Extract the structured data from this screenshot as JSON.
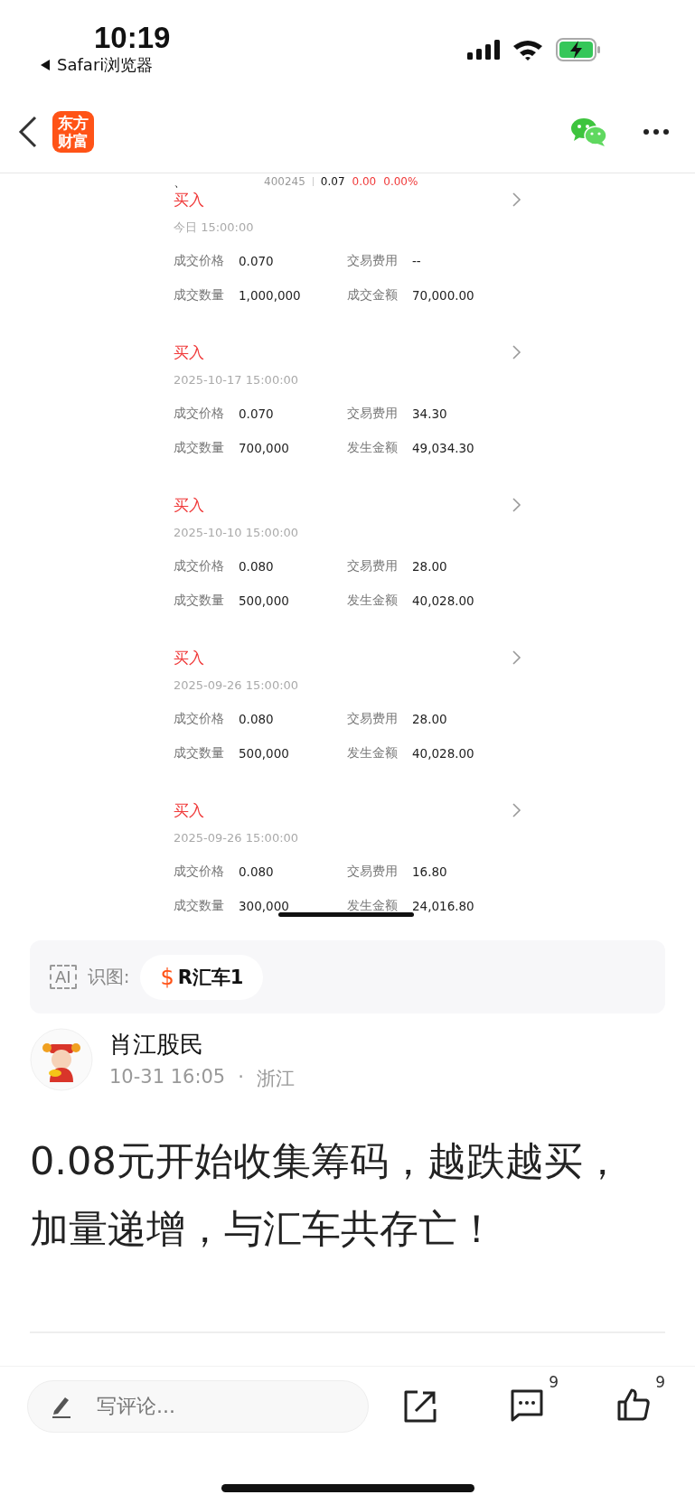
{
  "status_bar": {
    "time": "10:19",
    "back_app": "Safari浏览器"
  },
  "nav": {
    "logo": [
      "东方",
      "财富"
    ]
  },
  "shared_image": {
    "fragment": "、",
    "quote": {
      "code": "400245",
      "price": "0.07",
      "change": "0.00",
      "change_pct": "0.00%"
    },
    "trades": [
      {
        "action": "买入",
        "time": "今日  15:00:00",
        "fields": [
          {
            "label": "成交价格",
            "value": "0.070"
          },
          {
            "label": "交易费用",
            "value": "--"
          },
          {
            "label": "成交数量",
            "value": "1,000,000"
          },
          {
            "label": "成交金额",
            "value": "70,000.00"
          }
        ]
      },
      {
        "action": "买入",
        "time": "2025-10-17  15:00:00",
        "fields": [
          {
            "label": "成交价格",
            "value": "0.070"
          },
          {
            "label": "交易费用",
            "value": "34.30"
          },
          {
            "label": "成交数量",
            "value": "700,000"
          },
          {
            "label": "发生金额",
            "value": "49,034.30"
          }
        ]
      },
      {
        "action": "买入",
        "time": "2025-10-10  15:00:00",
        "fields": [
          {
            "label": "成交价格",
            "value": "0.080"
          },
          {
            "label": "交易费用",
            "value": "28.00"
          },
          {
            "label": "成交数量",
            "value": "500,000"
          },
          {
            "label": "发生金额",
            "value": "40,028.00"
          }
        ]
      },
      {
        "action": "买入",
        "time": "2025-09-26  15:00:00",
        "fields": [
          {
            "label": "成交价格",
            "value": "0.080"
          },
          {
            "label": "交易费用",
            "value": "28.00"
          },
          {
            "label": "成交数量",
            "value": "500,000"
          },
          {
            "label": "发生金额",
            "value": "40,028.00"
          }
        ]
      },
      {
        "action": "买入",
        "time": "2025-09-26  15:00:00",
        "fields": [
          {
            "label": "成交价格",
            "value": "0.080"
          },
          {
            "label": "交易费用",
            "value": "16.80"
          },
          {
            "label": "成交数量",
            "value": "300,000"
          },
          {
            "label": "发生金额",
            "value": "24,016.80"
          }
        ]
      }
    ]
  },
  "image_recognition": {
    "ai_mark": "AI",
    "label": "识图:",
    "tag_symbol": "$",
    "tag": "R汇车1"
  },
  "author": {
    "name": "肖江股民",
    "time": "10-31 16:05",
    "separator": "·",
    "location": "浙江"
  },
  "post_lines": [
    "0.08元开始收集筹码，越跌越买，",
    "加量递增，与汇车共存亡！"
  ],
  "bottom_bar": {
    "comment_placeholder": "写评论...",
    "comment_count": "9",
    "like_count": "9"
  }
}
